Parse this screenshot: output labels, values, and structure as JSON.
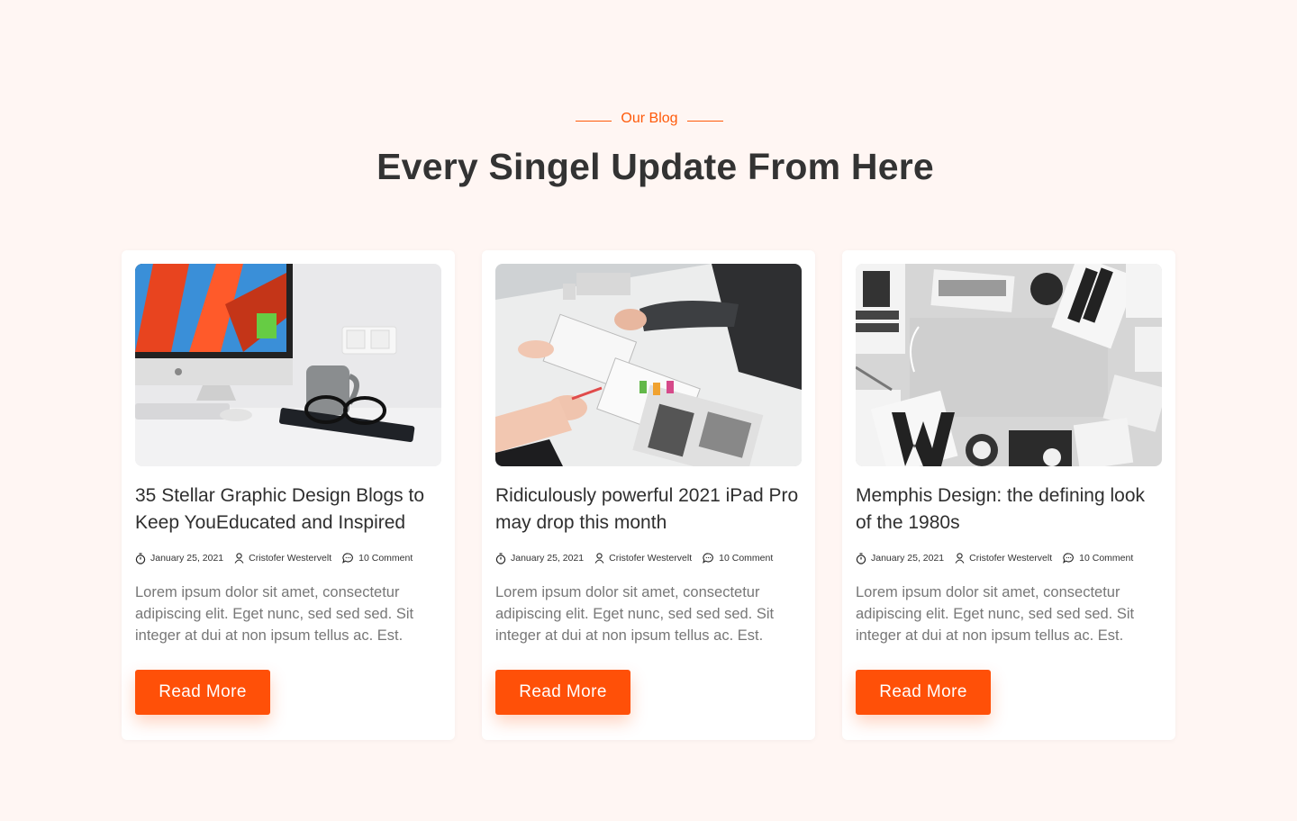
{
  "header": {
    "eyebrow": "Our Blog",
    "title": "Every Singel Update From Here"
  },
  "colors": {
    "accent": "#ff5a0a",
    "button": "#ff5008",
    "background": "#fff6f3"
  },
  "posts": [
    {
      "title": "35 Stellar Graphic Design Blogs to Keep YouEducated and Inspired",
      "date": "January 25, 2021",
      "author": "Cristofer Westervelt",
      "comments": "10 Comment",
      "excerpt": "Lorem ipsum dolor sit amet, consectetur adipiscing elit. Eget nunc, sed sed sed. Sit integer at dui at non ipsum tellus ac. Est.",
      "button": "Read More"
    },
    {
      "title": "Ridiculously powerful 2021 iPad Pro may drop this month",
      "date": "January 25, 2021",
      "author": "Cristofer Westervelt",
      "comments": "10 Comment",
      "excerpt": "Lorem ipsum dolor sit amet, consectetur adipiscing elit. Eget nunc, sed sed sed. Sit integer at dui at non ipsum tellus ac. Est.",
      "button": "Read More"
    },
    {
      "title": "Memphis Design: the defining look of the 1980s",
      "date": "January 25, 2021",
      "author": "Cristofer Westervelt",
      "comments": "10 Comment",
      "excerpt": "Lorem ipsum dolor sit amet, consectetur adipiscing elit. Eget nunc, sed sed sed. Sit integer at dui at non ipsum tellus ac. Est.",
      "button": "Read More"
    }
  ],
  "images": [
    "desk-computer-photo",
    "design-workspace-photo",
    "poster-collage-photo"
  ]
}
